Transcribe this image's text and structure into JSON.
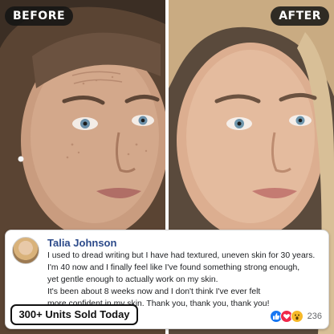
{
  "labels": {
    "before": "BEFORE",
    "after": "AFTER"
  },
  "review": {
    "author": "Talia Johnson",
    "lines": [
      "I used to dread writing but I have had textured, uneven skin for 30 years.",
      "I'm 40 now and I finally feel like I've found something strong enough,",
      "yet gentle enough to actually work on my skin.",
      "It's been about 8 weeks now and I don't think I've ever felt",
      "more confident in my skin. Thank you, thank you, thank you!"
    ],
    "reaction_count": "236"
  },
  "badge": {
    "label": "300+ Units Sold Today"
  },
  "icons": {
    "reactions": [
      "like-icon",
      "love-icon",
      "wow-icon"
    ]
  },
  "colors": {
    "author": "#2c4a8a",
    "like": "#1877f2",
    "love": "#f0284a",
    "wow": "#f7b928"
  }
}
